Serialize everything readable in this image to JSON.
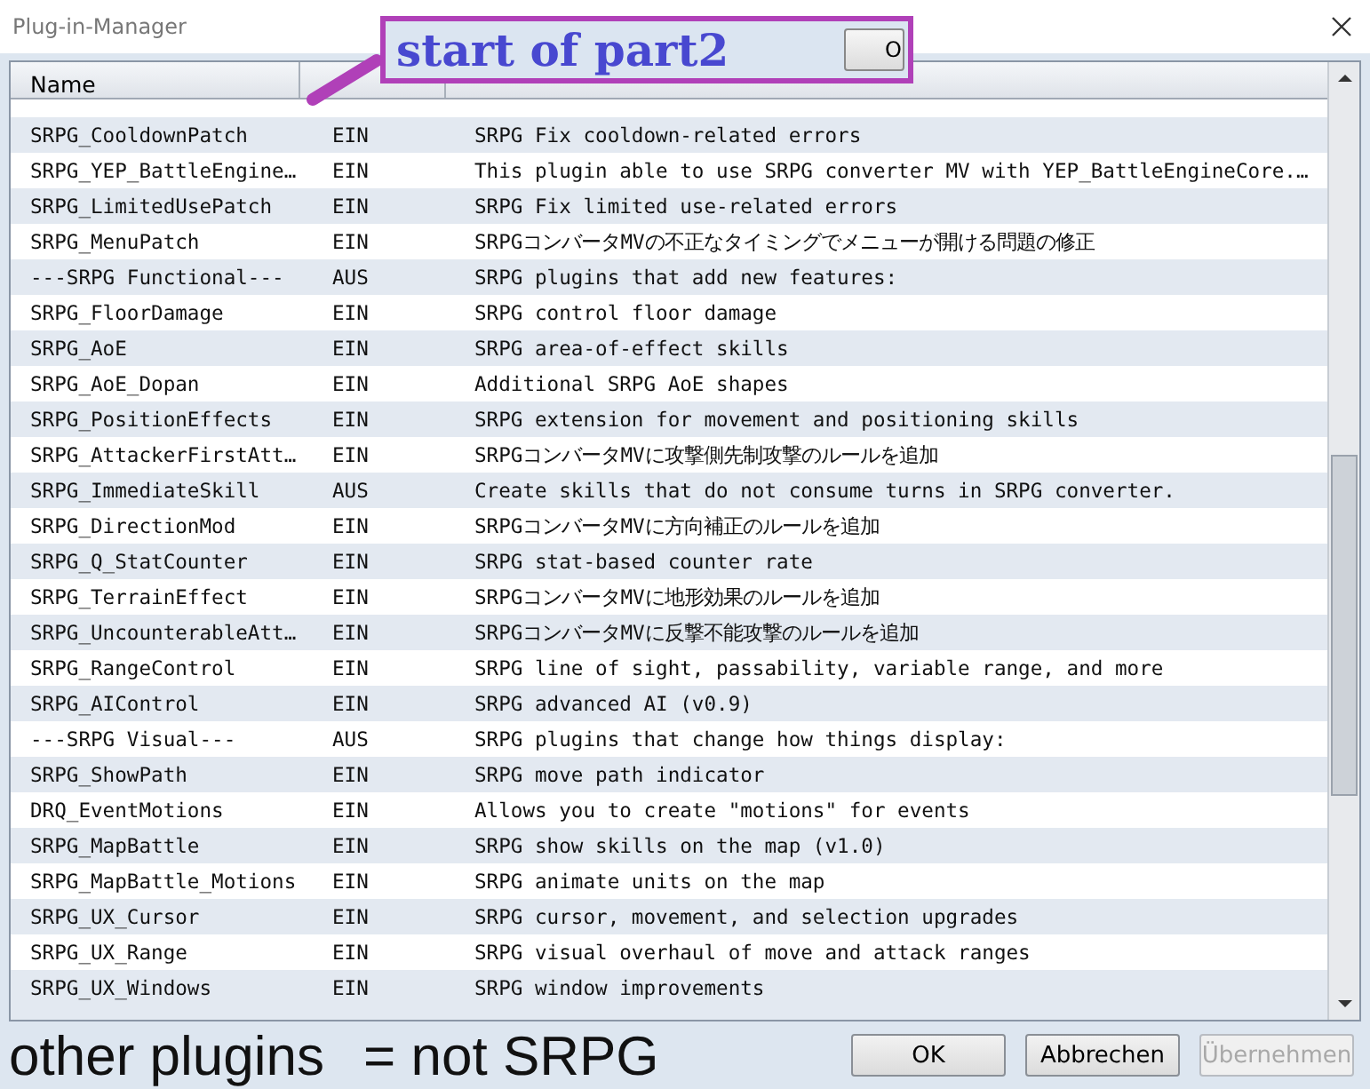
{
  "window": {
    "title": "Plug-in-Manager"
  },
  "table": {
    "columns": [
      "Name"
    ],
    "rows": [
      {
        "name": "SRPG_CooldownPatch",
        "status": "EIN",
        "description": "SRPG Fix cooldown-related errors"
      },
      {
        "name": "SRPG_YEP_BattleEngine…",
        "status": "EIN",
        "description": "This plugin able to use SRPG converter MV with YEP_BattleEngineCore.…"
      },
      {
        "name": "SRPG_LimitedUsePatch",
        "status": "EIN",
        "description": "SRPG Fix limited use-related errors"
      },
      {
        "name": "SRPG_MenuPatch",
        "status": "EIN",
        "description": "SRPGコンバータMVの不正なタイミングでメニューが開ける問題の修正"
      },
      {
        "name": "---SRPG Functional---",
        "status": "AUS",
        "description": "SRPG plugins that add new features:"
      },
      {
        "name": "SRPG_FloorDamage",
        "status": "EIN",
        "description": "SRPG control floor damage"
      },
      {
        "name": "SRPG_AoE",
        "status": "EIN",
        "description": "SRPG area-of-effect skills"
      },
      {
        "name": "SRPG_AoE_Dopan",
        "status": "EIN",
        "description": "Additional SRPG AoE shapes"
      },
      {
        "name": "SRPG_PositionEffects",
        "status": "EIN",
        "description": "SRPG extension for movement and positioning skills"
      },
      {
        "name": "SRPG_AttackerFirstAtt…",
        "status": "EIN",
        "description": "SRPGコンバータMVに攻撃側先制攻撃のルールを追加"
      },
      {
        "name": "SRPG_ImmediateSkill",
        "status": "AUS",
        "description": "Create skills that do not consume turns in SRPG converter."
      },
      {
        "name": "SRPG_DirectionMod",
        "status": "EIN",
        "description": "SRPGコンバータMVに方向補正のルールを追加"
      },
      {
        "name": "SRPG_Q_StatCounter",
        "status": "EIN",
        "description": "SRPG stat-based counter rate"
      },
      {
        "name": "SRPG_TerrainEffect",
        "status": "EIN",
        "description": "SRPGコンバータMVに地形効果のルールを追加"
      },
      {
        "name": "SRPG_UncounterableAtt…",
        "status": "EIN",
        "description": "SRPGコンバータMVに反撃不能攻撃のルールを追加"
      },
      {
        "name": "SRPG_RangeControl",
        "status": "EIN",
        "description": "SRPG line of sight, passability, variable range, and more"
      },
      {
        "name": "SRPG_AIControl",
        "status": "EIN",
        "description": "SRPG advanced AI (v0.9)"
      },
      {
        "name": "---SRPG Visual---",
        "status": "AUS",
        "description": "SRPG plugins that change how things display:"
      },
      {
        "name": "SRPG_ShowPath",
        "status": "EIN",
        "description": "SRPG move path indicator"
      },
      {
        "name": "DRQ_EventMotions",
        "status": "EIN",
        "description": "Allows you to create \"motions\" for events"
      },
      {
        "name": "SRPG_MapBattle",
        "status": "EIN",
        "description": "SRPG show skills on the map (v1.0)"
      },
      {
        "name": "SRPG_MapBattle_Motions",
        "status": "EIN",
        "description": "SRPG animate units on the map"
      },
      {
        "name": "SRPG_UX_Cursor",
        "status": "EIN",
        "description": "SRPG cursor, movement, and selection upgrades"
      },
      {
        "name": "SRPG_UX_Range",
        "status": "EIN",
        "description": "SRPG visual overhaul of move and attack ranges"
      },
      {
        "name": "SRPG_UX_Windows",
        "status": "EIN",
        "description": "SRPG window improvements"
      }
    ]
  },
  "buttons": [
    {
      "label": "OK",
      "disabled": false
    },
    {
      "label": "Abbrechen",
      "disabled": false
    },
    {
      "label": "Übernehmen",
      "disabled": true
    }
  ],
  "annotations": {
    "top": {
      "text": "start of part2",
      "button": "O"
    },
    "bottom": [
      {
        "text": "other plugins"
      },
      {
        "text": "= not SRPG"
      }
    ]
  }
}
